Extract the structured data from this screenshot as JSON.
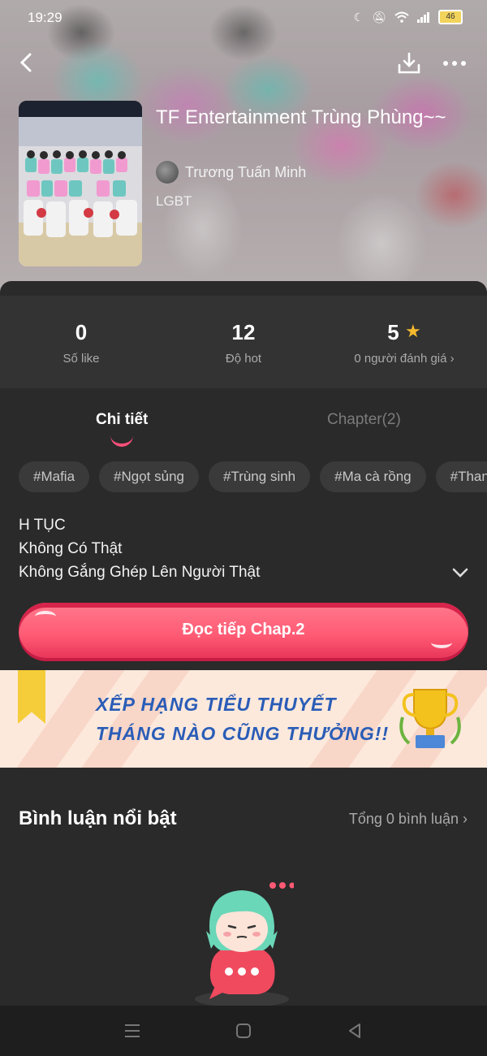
{
  "status_bar": {
    "time": "19:29",
    "battery": "46"
  },
  "book": {
    "title": "TF Entertainment Trùng Phùng~~",
    "author": "Trương Tuấn Minh",
    "genre": "LGBT"
  },
  "stats": [
    {
      "value": "0",
      "label": "Số like"
    },
    {
      "value": "12",
      "label": "Độ hot"
    },
    {
      "value": "5",
      "label": "0 người đánh giá"
    }
  ],
  "tabs": {
    "details": "Chi tiết",
    "chapters": "Chapter(2)"
  },
  "tags": [
    "#Mafia",
    "#Ngọt sủng",
    "#Trùng sinh",
    "#Ma cà rồng",
    "#Thanh"
  ],
  "description": [
    "H TỤC",
    "Không Có Thật",
    "Không Gắng Ghép Lên Người Thật"
  ],
  "read_button": "Đọc tiếp Chap.2",
  "banner": {
    "line1": "XẾP HẠNG TIỂU THUYẾT",
    "line2": "THÁNG NÀO CŨNG THƯỞNG!!"
  },
  "comments": {
    "title": "Bình luận nổi bật",
    "total": "Tổng 0 bình luận"
  },
  "colors": {
    "accent": "#ff5a74",
    "star": "#f5b82e",
    "banner_text": "#2a5db7"
  }
}
